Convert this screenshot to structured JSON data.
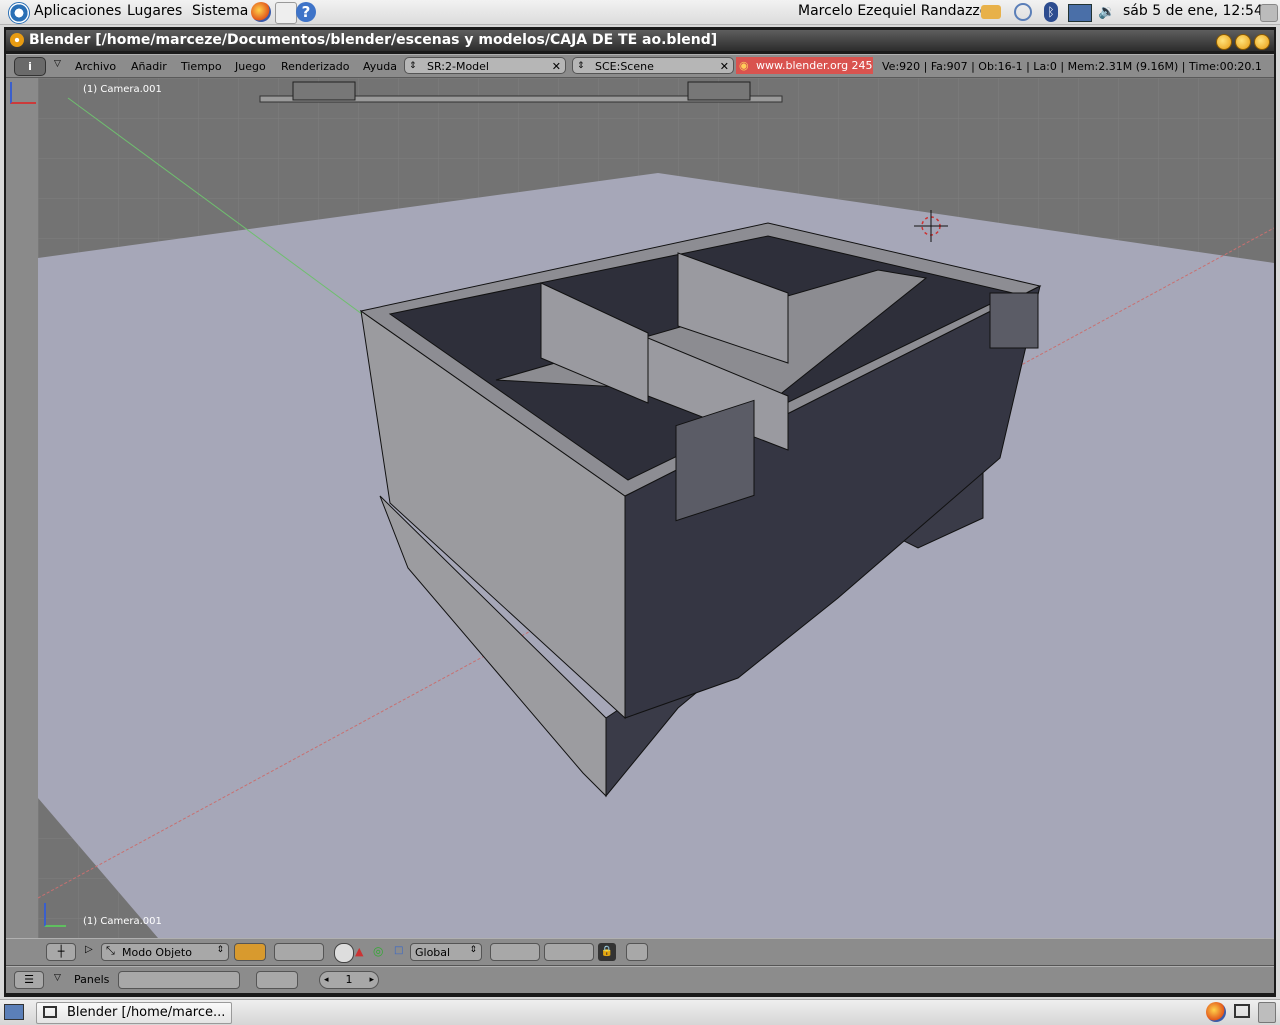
{
  "gnome_panel": {
    "menus": [
      "Aplicaciones",
      "Lugares",
      "Sistema"
    ],
    "user": "Marcelo Ezequiel Randazzo",
    "clock": "sáb  5 de ene, 12:54"
  },
  "window": {
    "title": "Blender [/home/marceze/Documentos/blender/escenas y modelos/CAJA DE TE ao.blend]"
  },
  "info_header": {
    "menus": [
      "Archivo",
      "Añadir",
      "Tiempo",
      "Juego",
      "Renderizado",
      "Ayuda"
    ],
    "screen_field": "SR:2-Model",
    "scene_field": "SCE:Scene",
    "site": "www.blender.org 245",
    "stats": "Ve:920 | Fa:907 | Ob:16-1 | La:0  | Mem:2.31M (9.16M)  | Time:00:20.1"
  },
  "viewport": {
    "object_label_top": "(1) Camera.001",
    "object_label_bottom": "(1) Camera.001"
  },
  "view3d_header": {
    "mode": "Modo Objeto",
    "orientation": "Global"
  },
  "buttons_header": {
    "panels_label": "Panels",
    "frame": "1"
  },
  "taskbar": {
    "task": "Blender [/home/marce..."
  },
  "colors": {
    "accent": "#e79b12",
    "site_badge": "#d9534f"
  }
}
